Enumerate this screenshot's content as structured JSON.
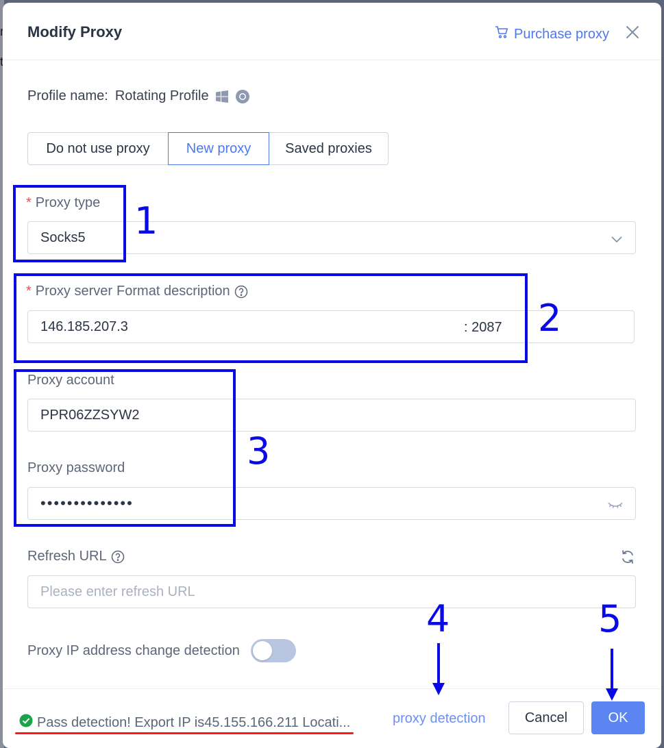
{
  "dialog": {
    "title": "Modify Proxy",
    "purchase_label": "Purchase proxy"
  },
  "profile": {
    "label": "Profile name:",
    "name": "Rotating Profile"
  },
  "proxy_mode": {
    "options": [
      "Do not use proxy",
      "New proxy",
      "Saved proxies"
    ],
    "selected": "New proxy"
  },
  "proxy_type": {
    "label": "Proxy type",
    "value": "Socks5"
  },
  "proxy_server": {
    "label": "Proxy server",
    "format_label": "Format description",
    "host": "146.185.207.3",
    "port_separator": ":",
    "port": "2087"
  },
  "proxy_account": {
    "label": "Proxy account",
    "value": "PPR06ZZSYW2"
  },
  "proxy_password": {
    "label": "Proxy password",
    "masked_value": "••••••••••••••"
  },
  "refresh_url": {
    "label": "Refresh URL",
    "placeholder": "Please enter refresh URL"
  },
  "ip_change_detection": {
    "label": "Proxy IP address change detection",
    "enabled": false
  },
  "footer": {
    "status_text": "Pass detection! Export IP is45.155.166.211 Locati...",
    "detect_label": "proxy detection",
    "cancel_label": "Cancel",
    "ok_label": "OK"
  },
  "annotations": {
    "markers": [
      "1",
      "2",
      "3",
      "4",
      "5"
    ],
    "color": "#0a0ae6",
    "underline_color": "#ff1a1a"
  },
  "colors": {
    "accent": "#4e78ef",
    "required": "#ee4d4d",
    "success": "#1aa34a"
  },
  "background": {
    "letters": [
      "r",
      "t"
    ]
  }
}
